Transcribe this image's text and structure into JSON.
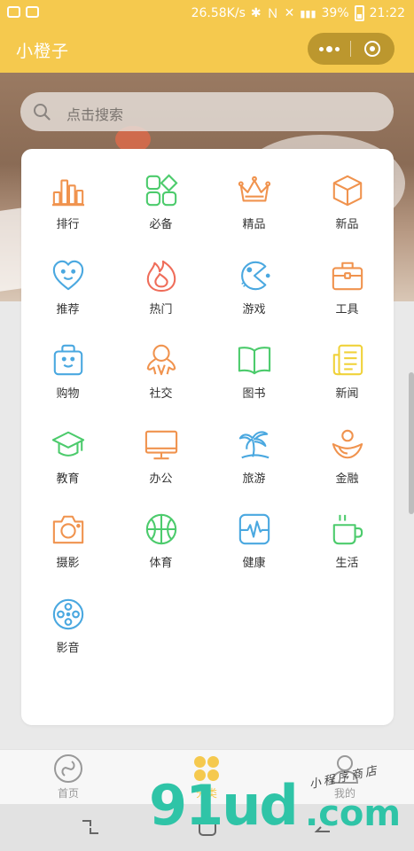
{
  "status_bar": {
    "speed": "26.58K/s",
    "battery": "39%",
    "time": "21:22"
  },
  "nav": {
    "title": "小橙子"
  },
  "search": {
    "placeholder": "点击搜索"
  },
  "categories": [
    {
      "label": "排行",
      "icon": "bar-chart-icon",
      "color": "#f0934e"
    },
    {
      "label": "必备",
      "icon": "grid-apps-icon",
      "color": "#4ccb6c"
    },
    {
      "label": "精品",
      "icon": "crown-icon",
      "color": "#f0934e"
    },
    {
      "label": "新品",
      "icon": "box-icon",
      "color": "#f0934e"
    },
    {
      "label": "推荐",
      "icon": "heart-smile-icon",
      "color": "#4aa8e0"
    },
    {
      "label": "热门",
      "icon": "flame-icon",
      "color": "#ef6d5a"
    },
    {
      "label": "游戏",
      "icon": "pacman-icon",
      "color": "#4aa8e0"
    },
    {
      "label": "工具",
      "icon": "toolbox-icon",
      "color": "#f0934e"
    },
    {
      "label": "购物",
      "icon": "shopping-bag-icon",
      "color": "#4aa8e0"
    },
    {
      "label": "社交",
      "icon": "social-figure-icon",
      "color": "#f0934e"
    },
    {
      "label": "图书",
      "icon": "open-book-icon",
      "color": "#4ccb6c"
    },
    {
      "label": "新闻",
      "icon": "newspaper-icon",
      "color": "#f0d23a"
    },
    {
      "label": "教育",
      "icon": "graduation-cap-icon",
      "color": "#4ccb6c"
    },
    {
      "label": "办公",
      "icon": "monitor-icon",
      "color": "#f0934e"
    },
    {
      "label": "旅游",
      "icon": "palm-tree-icon",
      "color": "#4aa8e0"
    },
    {
      "label": "金融",
      "icon": "finance-icon",
      "color": "#f0934e"
    },
    {
      "label": "摄影",
      "icon": "camera-icon",
      "color": "#f0934e"
    },
    {
      "label": "体育",
      "icon": "basketball-icon",
      "color": "#4ccb6c"
    },
    {
      "label": "健康",
      "icon": "heartbeat-icon",
      "color": "#4aa8e0"
    },
    {
      "label": "生活",
      "icon": "coffee-cup-icon",
      "color": "#4ccb6c"
    },
    {
      "label": "影音",
      "icon": "film-reel-icon",
      "color": "#4aa8e0"
    }
  ],
  "tabbar": {
    "home": "首页",
    "category": "分类",
    "mine": "我的",
    "active_color": "#f5c94e",
    "inactive_color": "#999999"
  },
  "watermark": {
    "main": "91ud",
    "suffix": ".com",
    "tagline": "小程序商店"
  }
}
